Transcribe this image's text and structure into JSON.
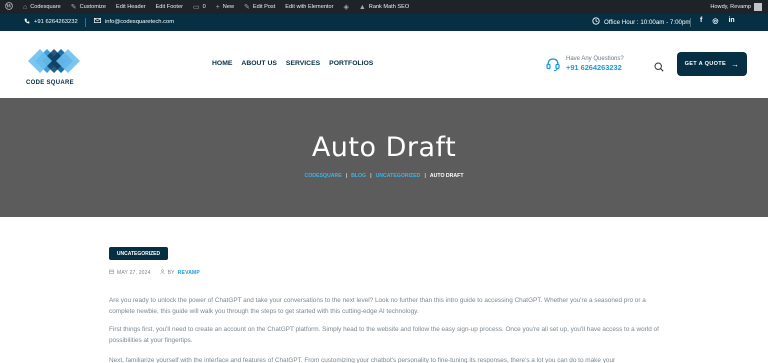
{
  "adminbar": {
    "items": [
      {
        "icon": "wordpress-icon",
        "label": ""
      },
      {
        "icon": "home-icon",
        "label": "Codesquare"
      },
      {
        "icon": "brush-icon",
        "label": "Customize"
      },
      {
        "icon": "",
        "label": "Edit Header"
      },
      {
        "icon": "",
        "label": "Edit Footer"
      },
      {
        "icon": "comment-icon",
        "label": "0"
      },
      {
        "icon": "plus-icon",
        "label": "New"
      },
      {
        "icon": "pencil-icon",
        "label": "Edit Post"
      },
      {
        "icon": "",
        "label": "Edit with Elementor"
      },
      {
        "icon": "elementor-icon",
        "label": ""
      },
      {
        "icon": "rankmath-icon",
        "label": "Rank Math SEO"
      }
    ],
    "greeting": "Howdy, Revamp"
  },
  "topbar": {
    "phone": "+91 6264263232",
    "email": "info@codesquaretech.com",
    "hours": "Office Hour : 10:00am - 7:00pm",
    "social": [
      "f",
      "◎",
      "in"
    ]
  },
  "header": {
    "logo_text": "CODE SQUARE",
    "nav": [
      "HOME",
      "ABOUT US",
      "SERVICES",
      "PORTFOLIOS"
    ],
    "contact_question": "Have Any Questions?",
    "contact_phone": "+91 6264263232",
    "quote_label": "GET A QUOTE",
    "colors": {
      "brand": "#062f43",
      "accent": "#1a9ad6"
    }
  },
  "banner": {
    "title": "Auto Draft",
    "breadcrumb": [
      "CODESQUARE",
      "BLOG",
      "UNCATEGORIZED",
      "AUTO DRAFT"
    ],
    "separator": "|"
  },
  "post": {
    "category": "UNCATEGORIZED",
    "date": "MAY 27, 2024",
    "by": "BY",
    "author": "REVAMP",
    "paragraphs": [
      "Are you ready to unlock the power of ChatGPT and take your conversations to the next level? Look no further than this intro guide to accessing ChatGPT. Whether you're a seasoned pro or a complete newbie, this guide will walk you through the steps to get started with this cutting-edge AI technology.",
      "First things first, you'll need to create an account on the ChatGPT platform. Simply head to the website and follow the easy sign-up process. Once you're all set up, you'll have access to a world of possibilities at your fingertips.",
      "Next, familiarize yourself with the interface and features of ChatGPT. From customizing your chatbot's personality to fine-tuning its responses, there's a lot you can do to make your"
    ]
  }
}
